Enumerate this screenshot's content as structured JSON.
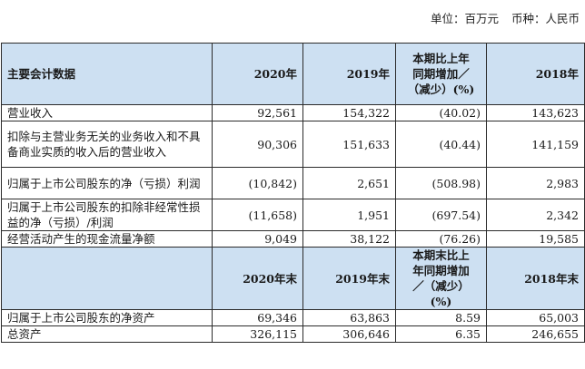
{
  "header": {
    "unit_label": "单位：",
    "unit_value": "百万元",
    "currency_label": "币种：",
    "currency_value": "人民币"
  },
  "table1": {
    "columns": [
      "主要会计数据",
      "2020年",
      "2019年",
      "本期比上年同期增加／（减少）(%)",
      "2018年"
    ],
    "change_header_lines": [
      "本期比上年",
      "同期增加／",
      "（减少）(%)"
    ],
    "rows": [
      {
        "label": "营业收入",
        "v2020": "92,561",
        "v2019": "154,322",
        "change": "(40.02)",
        "v2018": "143,623"
      },
      {
        "label": "扣除与主营业务无关的业务收入和不具备商业实质的收入后的营业收入",
        "v2020": "90,306",
        "v2019": "151,633",
        "change": "(40.44)",
        "v2018": "141,159"
      },
      {
        "label": "归属于上市公司股东的净（亏损）利润",
        "v2020": "(10,842)",
        "v2019": "2,651",
        "change": "(508.98)",
        "v2018": "2,983"
      },
      {
        "label": "归属于上市公司股东的扣除非经常性损益的净（亏损）/利润",
        "v2020": "(11,658)",
        "v2019": "1,951",
        "change": "(697.54)",
        "v2018": "2,342"
      },
      {
        "label": "经营活动产生的现金流量净额",
        "v2020": "9,049",
        "v2019": "38,122",
        "change": "(76.26)",
        "v2018": "19,585"
      }
    ]
  },
  "table2": {
    "columns": [
      "",
      "2020年末",
      "2019年末",
      "本期末比上年同期增加／（减少）(%)",
      "2018年末"
    ],
    "change_header_lines": [
      "本期末比上",
      "年同期增加",
      "／（减少）",
      "(%)"
    ],
    "rows": [
      {
        "label": "归属于上市公司股东的净资产",
        "v2020": "69,346",
        "v2019": "63,863",
        "change": "8.59",
        "v2018": "65,003"
      },
      {
        "label": "总资产",
        "v2020": "326,115",
        "v2019": "306,646",
        "change": "6.35",
        "v2018": "246,655"
      }
    ]
  }
}
